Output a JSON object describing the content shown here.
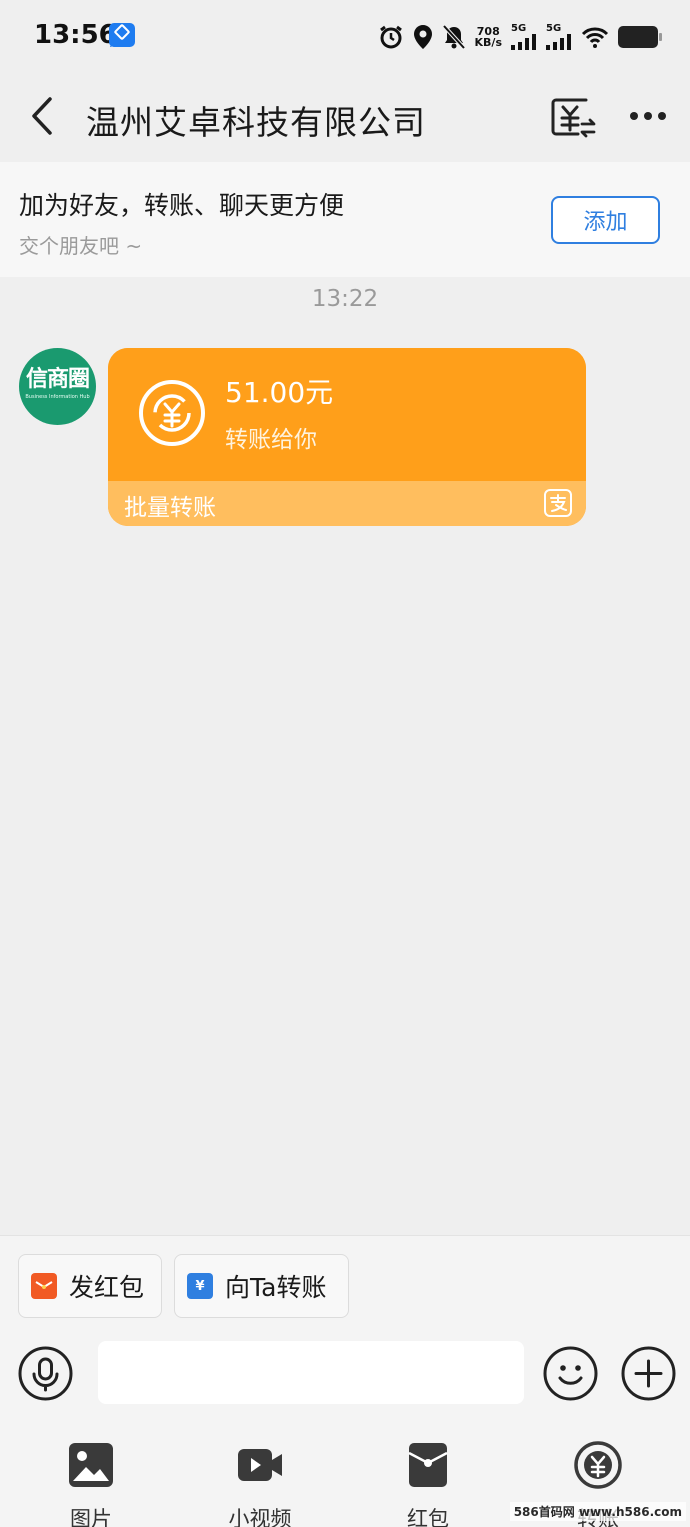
{
  "status_bar": {
    "time": "13:56",
    "ai_badge": "AI",
    "net_speed_value": "708",
    "net_speed_unit": "KB/s",
    "signal1_label": "5G",
    "signal2_label": "5G"
  },
  "header": {
    "title": "温州艾卓科技有限公司"
  },
  "friend_banner": {
    "title": "加为好友，转账、聊天更方便",
    "subtitle": "交个朋友吧 ~",
    "add_label": "添加"
  },
  "chat": {
    "timestamp": "13:22",
    "avatar": {
      "title": "信商圈",
      "subtitle": "Business Information Hub"
    },
    "transfer_card": {
      "amount": "51.00元",
      "description": "转账给你",
      "footer_label": "批量转账",
      "color_main": "#ff9f1a",
      "color_footer": "#ffbe5e"
    }
  },
  "quick_actions": [
    {
      "label": "发红包",
      "icon": "red-packet-icon",
      "color": "#f15a24"
    },
    {
      "label": "向Ta转账",
      "icon": "transfer-yuan-icon",
      "color": "#2f7fe0"
    }
  ],
  "toolbar": {
    "items": [
      {
        "label": "图片",
        "icon": "image-icon"
      },
      {
        "label": "小视频",
        "icon": "video-icon"
      },
      {
        "label": "红包",
        "icon": "red-packet-icon"
      },
      {
        "label": "转账",
        "icon": "transfer-icon"
      }
    ]
  },
  "watermark": "586首码网 www.h586.com"
}
